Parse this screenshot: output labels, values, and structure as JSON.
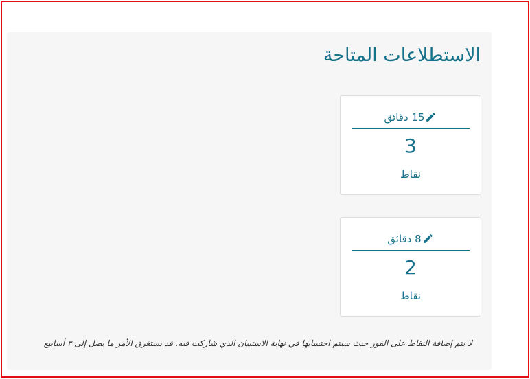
{
  "surveys": {
    "title": "الاستطلاعات المتاحة",
    "cards": [
      {
        "duration": "15 دقائق",
        "points": "3",
        "points_label": "نقاط",
        "icon": "pencil-icon"
      },
      {
        "duration": "8 دقائق",
        "points": "2",
        "points_label": "نقاط",
        "icon": "pencil-icon"
      }
    ],
    "note": "لا يتم إضافة النقاط على الفور حيث سيتم احتسابها في نهاية الاستبيان الذي شاركت فيه. قد يستغرق الأمر ما يصل إلى ٣ أسابيع"
  },
  "colors": {
    "accent": "#16718a",
    "frame": "#e10f14",
    "panel_bg": "#f6f6f6"
  }
}
